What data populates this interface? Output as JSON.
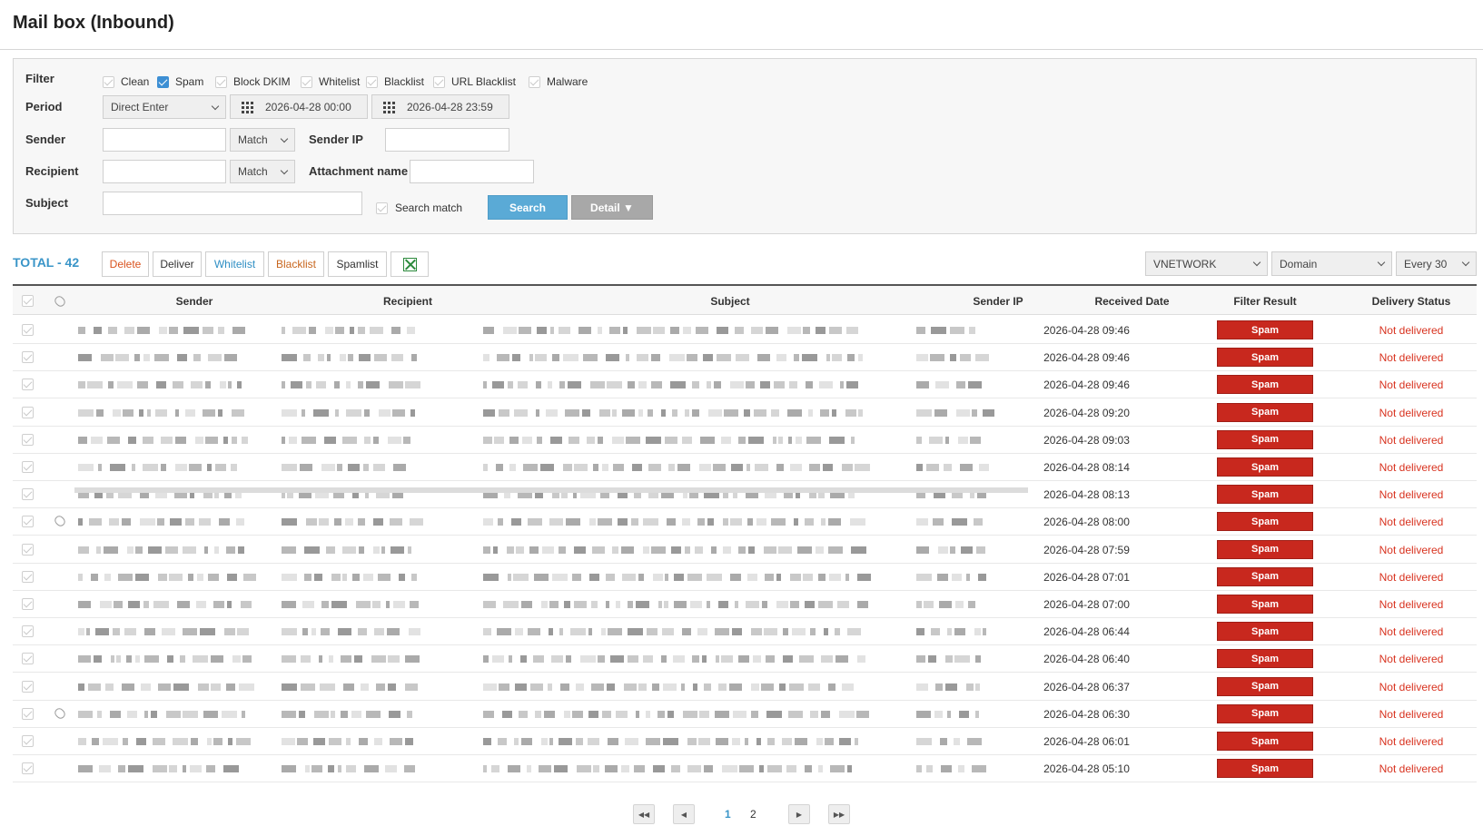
{
  "page": {
    "title": "Mail box (Inbound)"
  },
  "filter": {
    "label": "Filter",
    "options": [
      {
        "label": "Clean",
        "checked": false
      },
      {
        "label": "Spam",
        "checked": true
      },
      {
        "label": "Block DKIM",
        "checked": false
      },
      {
        "label": "Whitelist",
        "checked": false
      },
      {
        "label": "Blacklist",
        "checked": false
      },
      {
        "label": "URL Blacklist",
        "checked": false
      },
      {
        "label": "Malware",
        "checked": false
      }
    ]
  },
  "period": {
    "label": "Period",
    "mode": "Direct Enter",
    "start": "2026-04-28 00:00",
    "end": "2026-04-28 23:59"
  },
  "sender": {
    "label": "Sender",
    "match": "Match",
    "ip_label": "Sender IP"
  },
  "recipient": {
    "label": "Recipient",
    "match": "Match",
    "attachment_label": "Attachment name"
  },
  "subject": {
    "label": "Subject",
    "search_match_label": "Search match"
  },
  "buttons": {
    "search": "Search",
    "detail": "Detail ▼"
  },
  "toolbar": {
    "total": "TOTAL - 42",
    "delete": "Delete",
    "deliver": "Deliver",
    "whitelist": "Whitelist",
    "blacklist": "Blacklist",
    "spamlist": "Spamlist",
    "org": "VNETWORK",
    "domain": "Domain",
    "per_page": "Every 30"
  },
  "table": {
    "columns": {
      "sender": "Sender",
      "recipient": "Recipient",
      "subject": "Subject",
      "sender_ip": "Sender IP",
      "received_date": "Received Date",
      "filter_result": "Filter Result",
      "delivery_status": "Delivery Status"
    },
    "rows": [
      {
        "attach": false,
        "date": "2026-04-28 09:46",
        "result": "Spam",
        "status": "Not delivered"
      },
      {
        "attach": false,
        "date": "2026-04-28 09:46",
        "result": "Spam",
        "status": "Not delivered"
      },
      {
        "attach": false,
        "date": "2026-04-28 09:46",
        "result": "Spam",
        "status": "Not delivered"
      },
      {
        "attach": false,
        "date": "2026-04-28 09:20",
        "result": "Spam",
        "status": "Not delivered"
      },
      {
        "attach": false,
        "date": "2026-04-28 09:03",
        "result": "Spam",
        "status": "Not delivered"
      },
      {
        "attach": false,
        "date": "2026-04-28 08:14",
        "result": "Spam",
        "status": "Not delivered"
      },
      {
        "attach": false,
        "date": "2026-04-28 08:13",
        "result": "Spam",
        "status": "Not delivered"
      },
      {
        "attach": true,
        "date": "2026-04-28 08:00",
        "result": "Spam",
        "status": "Not delivered"
      },
      {
        "attach": false,
        "date": "2026-04-28 07:59",
        "result": "Spam",
        "status": "Not delivered"
      },
      {
        "attach": false,
        "date": "2026-04-28 07:01",
        "result": "Spam",
        "status": "Not delivered"
      },
      {
        "attach": false,
        "date": "2026-04-28 07:00",
        "result": "Spam",
        "status": "Not delivered"
      },
      {
        "attach": false,
        "date": "2026-04-28 06:44",
        "result": "Spam",
        "status": "Not delivered"
      },
      {
        "attach": false,
        "date": "2026-04-28 06:40",
        "result": "Spam",
        "status": "Not delivered"
      },
      {
        "attach": false,
        "date": "2026-04-28 06:37",
        "result": "Spam",
        "status": "Not delivered"
      },
      {
        "attach": true,
        "date": "2026-04-28 06:30",
        "result": "Spam",
        "status": "Not delivered"
      },
      {
        "attach": false,
        "date": "2026-04-28 06:01",
        "result": "Spam",
        "status": "Not delivered"
      },
      {
        "attach": false,
        "date": "2026-04-28 05:10",
        "result": "Spam",
        "status": "Not delivered"
      }
    ]
  },
  "pagination": {
    "pages": [
      "1",
      "2"
    ],
    "current": "1"
  },
  "colors": {
    "accent": "#3a95c8",
    "spam_badge": "#c8281e",
    "not_delivered": "#d8321f",
    "delete": "#d9531e",
    "whitelist": "#2f8fc4",
    "blacklist": "#c8661e"
  }
}
